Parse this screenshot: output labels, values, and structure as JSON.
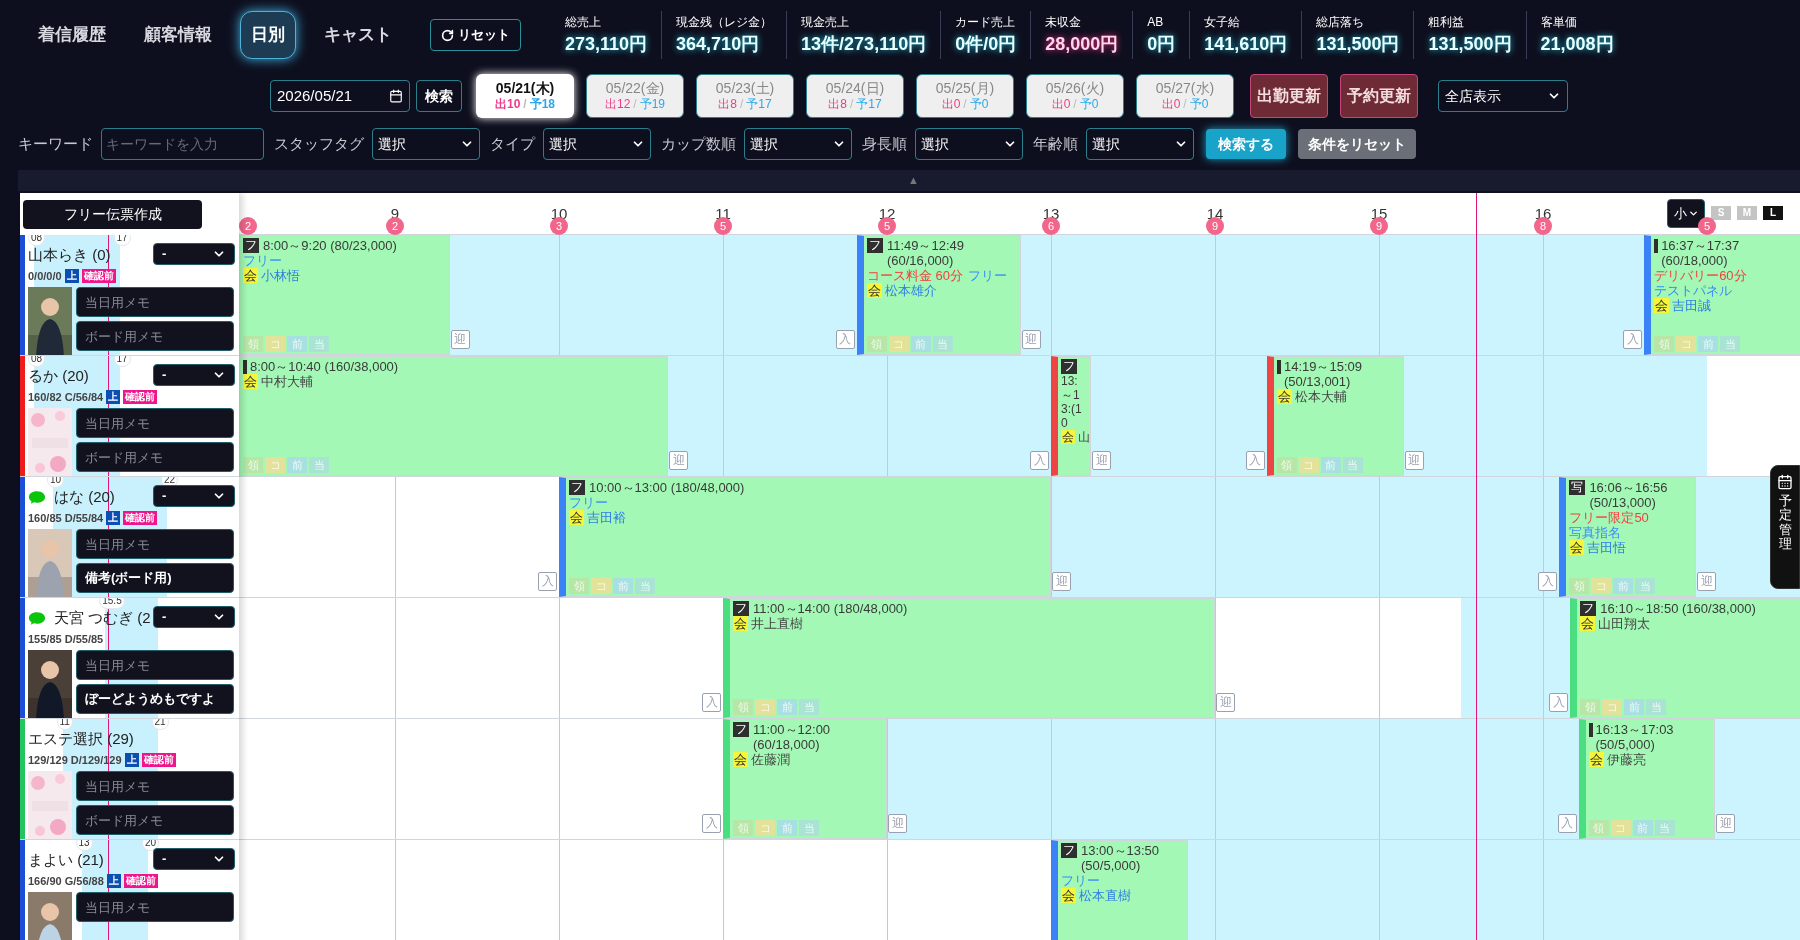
{
  "nav": {
    "tabs": [
      {
        "label": "着信履歴",
        "selected": false
      },
      {
        "label": "顧客情報",
        "selected": false
      },
      {
        "label": "日別",
        "selected": true
      },
      {
        "label": "キャスト",
        "selected": false
      }
    ],
    "reset": "リセット"
  },
  "stats": [
    {
      "label": "総売上",
      "value": "273,110円",
      "alert": false
    },
    {
      "label": "現金残（レジ金）",
      "value": "364,710円",
      "alert": false
    },
    {
      "label": "現金売上",
      "value": "13件/273,110円",
      "alert": false
    },
    {
      "label": "カード売上",
      "value": "0件/0円",
      "alert": false
    },
    {
      "label": "未収金",
      "value": "28,000円",
      "alert": true
    },
    {
      "label": "AB",
      "value": "0円",
      "alert": false
    },
    {
      "label": "女子給",
      "value": "141,610円",
      "alert": false
    },
    {
      "label": "総店落ち",
      "value": "131,500円",
      "alert": false
    },
    {
      "label": "粗利益",
      "value": "131,500円",
      "alert": false
    },
    {
      "label": "客単価",
      "value": "21,008円",
      "alert": false
    }
  ],
  "date_bar": {
    "date": "2026/05/21",
    "search": "検索",
    "days": [
      {
        "date": "05/21(木)",
        "shifts": "出10",
        "sep": "/",
        "reservations": "予18",
        "selected": true
      },
      {
        "date": "05/22(金)",
        "shifts": "出12",
        "sep": "/",
        "reservations": "予19",
        "selected": false
      },
      {
        "date": "05/23(土)",
        "shifts": "出8",
        "sep": "/",
        "reservations": "予17",
        "selected": false
      },
      {
        "date": "05/24(日)",
        "shifts": "出8",
        "sep": "/",
        "reservations": "予17",
        "selected": false
      },
      {
        "date": "05/25(月)",
        "shifts": "出0",
        "sep": "/",
        "reservations": "予0",
        "selected": false
      },
      {
        "date": "05/26(火)",
        "shifts": "出0",
        "sep": "/",
        "reservations": "予0",
        "selected": false
      },
      {
        "date": "05/27(水)",
        "shifts": "出0",
        "sep": "/",
        "reservations": "予0",
        "selected": false
      }
    ],
    "buttons": [
      "出勤更新",
      "予約更新"
    ],
    "store_select": "全店表示"
  },
  "filters": {
    "keyword_label": "キーワード",
    "keyword_placeholder": "キーワードを入力",
    "selects": [
      {
        "label": "スタッフタグ",
        "value": "選択"
      },
      {
        "label": "タイプ",
        "value": "選択"
      },
      {
        "label": "カップ数順",
        "value": "選択"
      },
      {
        "label": "身長順",
        "value": "選択"
      },
      {
        "label": "年齢順",
        "value": "選択"
      }
    ],
    "search": "検索する",
    "reset": "条件をリセット"
  },
  "collapse": "▲",
  "timeline": {
    "create_button": "フリー伝票作成",
    "hours": [
      "9",
      "10",
      "11",
      "12",
      "13",
      "14",
      "15",
      "16"
    ],
    "hour_counts": [
      "2",
      "2",
      "3",
      "5",
      "5",
      "6",
      "9",
      "9",
      "8",
      "5"
    ],
    "zoom_select": "小",
    "sizes": [
      {
        "label": "S",
        "selected": false
      },
      {
        "label": "M",
        "selected": false
      },
      {
        "label": "L",
        "selected": true
      }
    ],
    "casts": [
      {
        "name": "山本らき (0)",
        "chat": false,
        "shift_start": "08",
        "shift_end": "17",
        "stats": "0/0/0/0",
        "badges": [
          "上",
          "確認前"
        ],
        "select": "-",
        "color": "#1d4ed8",
        "memo_day": {
          "placeholder": "当日用メモ"
        },
        "memo_board": {
          "placeholder": "ボード用メモ"
        },
        "bookings": [
          {
            "time": "8:00～9:20 (80/23,000)",
            "badge": "フ",
            "type": "フリー",
            "member_tag": "会",
            "customer": "小林悟",
            "linked": true,
            "tags": [
              "領",
              "コ",
              "前",
              "当"
            ],
            "pickup": "迎"
          },
          {
            "time": "11:49～12:49 (60/16,000)",
            "badge": "フ",
            "course": "コース料金 60分",
            "type": "フリー",
            "member_tag": "会",
            "customer": "松本雄介",
            "linked": true,
            "tags": [
              "領",
              "コ",
              "前",
              "当"
            ],
            "check_in": "入",
            "pickup": "迎",
            "color": "#3b82f6"
          },
          {
            "time": "16:37～17:37 (60/18,000)",
            "course": "デリバリー60分",
            "type": "テストパネル",
            "member_tag": "会",
            "customer": "吉田誠",
            "linked": true,
            "tags": [
              "領",
              "コ",
              "前",
              "当"
            ],
            "check_in": "入",
            "color": "#3b82f6"
          }
        ]
      },
      {
        "name": "るか (20)",
        "chat": false,
        "shift_start": "08",
        "shift_end": "17",
        "stats": "160/82 C/56/84",
        "badges": [
          "上",
          "確認前"
        ],
        "select": "-",
        "color": "#ef1c1c",
        "memo_day": {
          "placeholder": "当日用メモ"
        },
        "memo_board": {
          "placeholder": "ボード用メモ"
        },
        "bookings": [
          {
            "time": "8:00～10:40 (160/38,000)",
            "member_tag": "会",
            "customer": "中村大輔",
            "linked": false,
            "tags": [
              "領",
              "コ",
              "前",
              "当"
            ],
            "pickup": "迎"
          },
          {
            "time": "13:～13:(10",
            "badge": "フ",
            "member_tag": "会",
            "customer": "山",
            "linked": false,
            "check_in": "入",
            "pickup": "迎",
            "color": "#ef4444"
          },
          {
            "time": "14:19～15:09 (50/13,001)",
            "member_tag": "会",
            "customer": "松本大輔",
            "linked": false,
            "tags": [
              "領",
              "コ",
              "前",
              "当"
            ],
            "check_in": "入",
            "pickup": "迎",
            "color": "#ef4444"
          }
        ]
      },
      {
        "name": "はな (20)",
        "chat": true,
        "shift_start": "10",
        "shift_end": "22",
        "stats": "160/85 D/55/84",
        "badges": [
          "上",
          "確認前"
        ],
        "select": "-",
        "color": "#1d4ed8",
        "memo_day": {
          "placeholder": "当日用メモ"
        },
        "memo_board": {
          "value": "備考(ボード用)"
        },
        "bookings": [
          {
            "time": "10:00～13:00 (180/48,000)",
            "badge": "フ",
            "type": "フリー",
            "member_tag": "会",
            "customer": "吉田裕",
            "linked": true,
            "tags": [
              "領",
              "コ",
              "前",
              "当"
            ],
            "check_in": "入",
            "pickup": "迎",
            "color": "#3b82f6"
          },
          {
            "time": "16:06～16:56 (50/13,000)",
            "badge": "写",
            "course": "フリー限定50",
            "type": "写真指名",
            "member_tag": "会",
            "customer": "吉田悟",
            "linked": true,
            "tags": [
              "領",
              "コ",
              "前",
              "当"
            ],
            "check_in": "入",
            "pickup": "迎",
            "color": "#3b82f6"
          }
        ]
      },
      {
        "name": "天宮 つむぎ (2",
        "chat": true,
        "shift_start": "15.5",
        "stats": "155/85 D/55/85",
        "select": "-",
        "color": "#1d4ed8",
        "memo_day": {
          "placeholder": "当日用メモ"
        },
        "memo_board": {
          "value": "ぼーどようめもですよ"
        },
        "bookings": [
          {
            "time": "11:00～14:00 (180/48,000)",
            "badge": "フ",
            "member_tag": "会",
            "customer": "井上直樹",
            "linked": false,
            "tags": [
              "領",
              "コ",
              "前",
              "当"
            ],
            "check_in": "入",
            "pickup": "迎",
            "color": "#4ade80"
          },
          {
            "time": "16:10～18:50 (160/38,000)",
            "badge": "フ",
            "member_tag": "会",
            "customer": "山田翔太",
            "linked": false,
            "tags": [
              "領",
              "コ",
              "前",
              "当"
            ],
            "check_in": "入",
            "color": "#4ade80"
          }
        ]
      },
      {
        "name": "エステ選択 (29)",
        "chat": false,
        "shift_start": "11",
        "shift_end": "21",
        "stats": "129/129 D/129/129",
        "badges": [
          "上",
          "確認前"
        ],
        "color": "#22c55e",
        "memo_day": {
          "placeholder": "当日用メモ"
        },
        "memo_board": {
          "placeholder": "ボード用メモ"
        },
        "bookings": [
          {
            "time": "11:00～12:00 (60/18,000)",
            "badge": "フ",
            "member_tag": "会",
            "customer": "佐藤潤",
            "linked": false,
            "tags": [
              "領",
              "コ",
              "前",
              "当"
            ],
            "check_in": "入",
            "pickup": "迎",
            "color": "#4ade80"
          },
          {
            "time": "16:13～17:03 (50/5,000)",
            "member_tag": "会",
            "customer": "伊藤亮",
            "linked": false,
            "tags": [
              "領",
              "コ",
              "前",
              "当"
            ],
            "check_in": "入",
            "pickup": "迎",
            "color": "#4ade80"
          }
        ]
      },
      {
        "name": "まよい (21)",
        "chat": false,
        "shift_start": "13",
        "shift_end": "20",
        "stats": "166/90 G/56/88",
        "badges": [
          "上",
          "確認前"
        ],
        "select": "-",
        "color": "#1d4ed8",
        "memo_day": {
          "placeholder": "当日用メモ"
        },
        "bookings": [
          {
            "time": "13:00～13:50 (50/5,000)",
            "badge": "フ",
            "type": "フリー",
            "member_tag": "会",
            "customer": "松本直樹",
            "linked": true,
            "color": "#3b82f6"
          }
        ]
      }
    ]
  },
  "side_tab": {
    "label": "予定管理"
  }
}
